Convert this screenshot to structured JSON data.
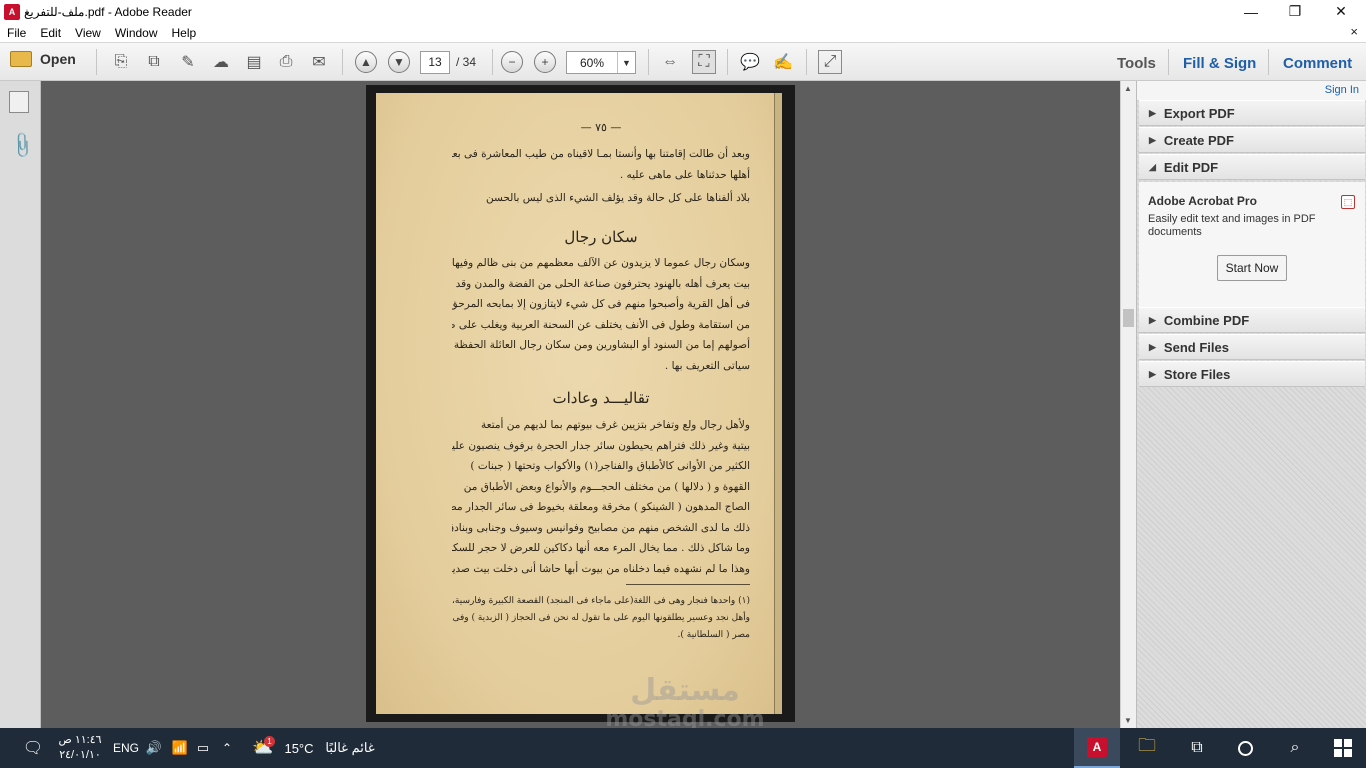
{
  "window": {
    "title": "ملف-للتفريغ.pdf - Adobe Reader",
    "app_icon": "adobe-reader-icon",
    "controls": {
      "minimize": "—",
      "maximize": "❐",
      "close": "✕"
    }
  },
  "menu": {
    "items": [
      "File",
      "Edit",
      "View",
      "Window",
      "Help"
    ],
    "close_doc": "×"
  },
  "toolbar": {
    "open_label": "Open",
    "current_page": "13",
    "total_pages": "/ 34",
    "zoom": "60%",
    "tools_label": "Tools",
    "fill_sign_label": "Fill & Sign",
    "comment_label": "Comment",
    "accent": "#1f5fa8"
  },
  "document": {
    "page_number": "— ٧٥ —",
    "para1": [
      "وبعد أن طالت إقامتنا بها وأنستا بمـا لاقيناه من طيب المعاشرة فى بعض",
      "أهلها حدثناها على ماهى عليه .",
      "بلاد ألفناها على كل حالة      وقد يؤلف الشيء الذى ليس بالحسن"
    ],
    "heading1": "سكان رجال",
    "para2": [
      "وسكان رجال عموما لا يزيدون عن الآلف معظمهم من بنى ظالم وفيها",
      "بيت يعرف أهله بالهنود يحترفون صناعة الحلى من الفضة والمدن وقد اندمجوا",
      "فى أهل القرية وأصبحوا منهم فى كل شيء لايتازون إلا بمابحه المرحق أفرادهم",
      "من استقامة وطول فى الأنف يختلف عن السحنة العربية ويغلب على ظنى أن",
      "أصولهم إما من السنود أو البشاورين ومن سكان رجال العائلة الحفظة التى",
      "سياتى التعريف بها ."
    ],
    "heading2": "تقاليـــد وعادات",
    "para3": [
      "ولأهل رجال ولع وتفاخر بتزيين غرف بيوتهم بما لديهم من أمتعة",
      "بيتية وغير ذلك فتراهم يحيطون سائر جدار الحجرة برفوف ينصبون عليها",
      "الكثير من الأوانى كالأطباق والفناجر(١) والأكواب وتحتها ( جبنات )",
      "القهوة و ( دلالها ) من مختلف الحجـــوم والأنواع وبعض الأطباق من",
      "الصاج المدهون ( الشينكو ) مخرقة ومعلقة بخيوط فى سائر الجدار مضافا إلى",
      "ذلك ما لدى الشخص منهم من مصابيح وفوانيس وسيوف وجنابى وبنادق",
      "وما شاكل ذلك . مما يخال المرء معه أنها دكاكين للعرض لا حجر للسكن .",
      "وهذا ما لم نشهده فيما دخلناه من بيوت أبها حاشا أنى دخلت بيت صديق"
    ],
    "footnote": [
      "(١) واحدها فنجار وهى فى اللغة(على ماجاء فى المنجد) القصعة الكبيرة وفارسية،",
      "وأهل نجد وعسير يطلقونها اليوم على ما تقول له نحن فى الحجاز ( الزبدية ) وفى",
      "مصر ( السلطانية )."
    ]
  },
  "right_panel": {
    "sign_in": "Sign In",
    "sections": [
      "Export PDF",
      "Create PDF",
      "Edit PDF"
    ],
    "edit": {
      "product": "Adobe Acrobat Pro",
      "description": "Easily edit text and images in PDF documents",
      "button": "Start Now"
    },
    "more_sections": [
      "Combine PDF",
      "Send Files",
      "Store Files"
    ]
  },
  "taskbar": {
    "time": "١١:٤٦ ص",
    "date": "٢٤/٠١/١٠",
    "lang": "ENG",
    "weather_temp": "15°C",
    "weather_text": "غائم غالبًا",
    "weather_badge": "1"
  },
  "watermark": {
    "logo": "مستقل",
    "url": "mostaql.com"
  }
}
